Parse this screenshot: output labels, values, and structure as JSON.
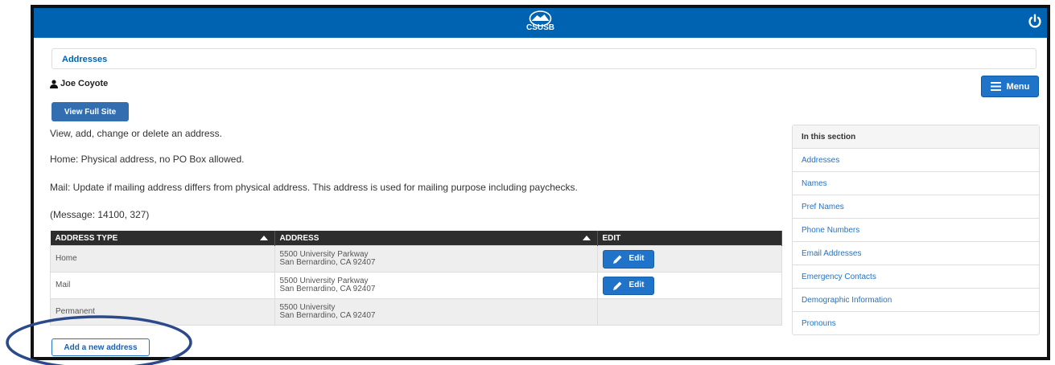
{
  "header": {
    "logo_text": "CSUSB",
    "bar_color": "#0063b1",
    "logo_icon": "csusb-mountain-logo",
    "power_icon": "power-icon"
  },
  "breadcrumb": {
    "label": "Addresses"
  },
  "user": {
    "name": "Joe Coyote",
    "icon": "user-icon"
  },
  "menu_button": {
    "label": "Menu",
    "icon": "hamburger-icon"
  },
  "view_full_site": {
    "label": "View Full Site"
  },
  "content": {
    "intro": "View, add, change or delete an address.",
    "home_note": "Home: Physical address, no PO Box allowed.",
    "mail_note": "Mail: Update if mailing address differs from physical address. This address is used for mailing purpose including paychecks.",
    "message": "(Message: 14100, 327)"
  },
  "table": {
    "headers": [
      "ADDRESS TYPE",
      "ADDRESS",
      "EDIT"
    ],
    "rows": [
      {
        "type": "Home",
        "line1": "5500 University Parkway",
        "line2": "San Bernardino, CA 92407",
        "edit": "Edit"
      },
      {
        "type": "Mail",
        "line1": "5500 University Parkway",
        "line2": "San Bernardino, CA 92407",
        "edit": "Edit"
      },
      {
        "type": "Permanent",
        "line1": "5500 University",
        "line2": "San Bernardino, CA 92407",
        "edit": ""
      }
    ]
  },
  "sidebar": {
    "title": "In this section",
    "items": [
      {
        "label": "Addresses"
      },
      {
        "label": "Names"
      },
      {
        "label": "Pref Names"
      },
      {
        "label": "Phone Numbers"
      },
      {
        "label": "Email Addresses"
      },
      {
        "label": "Emergency Contacts"
      },
      {
        "label": "Demographic Information"
      },
      {
        "label": "Pronouns"
      }
    ]
  },
  "add_button": {
    "label": "Add a new address"
  },
  "colors": {
    "primary": "#1f73c9",
    "table_header": "#2d2d2d",
    "annotation": "#2b4a8c"
  }
}
